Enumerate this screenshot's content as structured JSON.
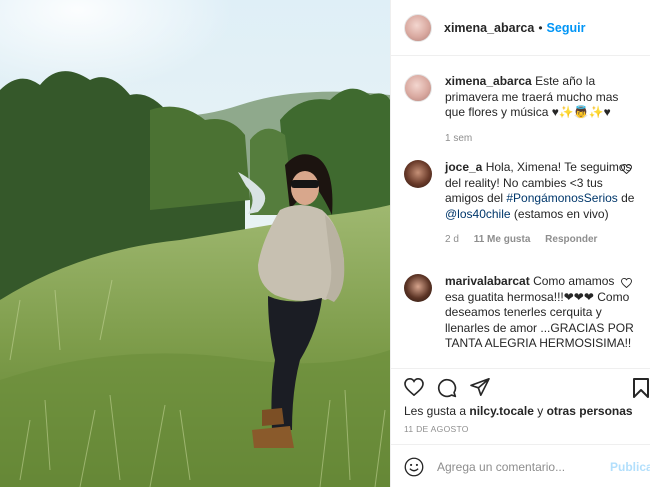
{
  "post": {
    "username": "ximena_abarca",
    "separator": "•",
    "follow_label": "Seguir"
  },
  "caption": {
    "username": "ximena_abarca",
    "text": "Este año la primavera me traerá mucho mas que flores y música ♥✨👼✨♥",
    "age": "1 sem"
  },
  "comments": [
    {
      "username": "joce_a",
      "text_before": "Hola, Ximena! Te seguimos del reality! No cambies <3 tus amigos del",
      "hashtag": "#PongámonosSerios",
      "text_mid": "de",
      "mention": "@los40chile",
      "text_after": "(estamos en vivo)",
      "age": "2 d",
      "likes": "11 Me gusta",
      "reply_label": "Responder"
    },
    {
      "username": "marivalabarcat",
      "text": "Como amamos esa guatita hermosa!!!❤❤❤ Como deseamos tenerles cerquita y llenarles de amor ...GRACIAS POR TANTA ALEGRIA HERMOSISIMA!!"
    }
  ],
  "likes_line": {
    "prefix": "Les gusta a",
    "user": "nilcy.tocale",
    "conj": "y",
    "others": "otras personas"
  },
  "date": "11 DE AGOSTO",
  "add_comment": {
    "placeholder": "Agrega un comentario...",
    "publish_label": "Publicar"
  },
  "icons": [
    "heart-icon",
    "comment-icon",
    "share-icon",
    "bookmark-icon",
    "emoji-icon"
  ],
  "colors": {
    "link": "#0095f6",
    "muted": "#8e8e8e",
    "publish_disabled": "#b2dffc"
  }
}
